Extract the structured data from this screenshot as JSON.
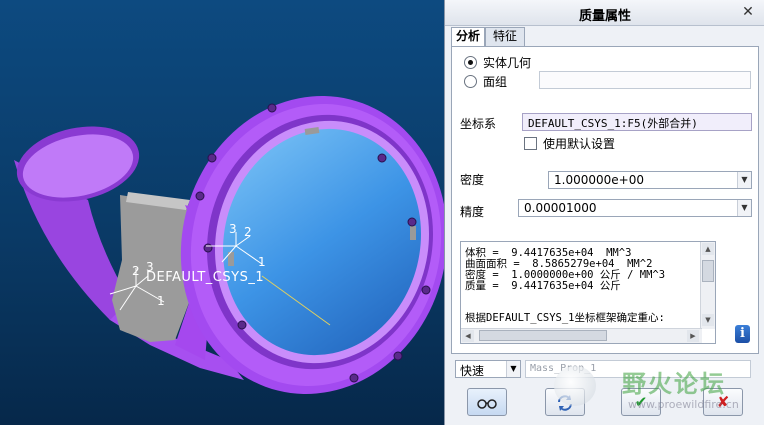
{
  "viewport": {
    "csys_label": "DEFAULT_CSYS_1",
    "axis_labels": [
      "3",
      "2",
      "1",
      "2",
      "3",
      "1"
    ],
    "colors": {
      "part": "#b04ef0",
      "inner": "#3d94e6",
      "web": "#9a9a9a",
      "background": "#0d4a80"
    }
  },
  "dialog": {
    "title": "质量属性",
    "close_icon": "close-icon",
    "tabs": [
      {
        "label": "分析",
        "active": true
      },
      {
        "label": "特征",
        "active": false
      }
    ],
    "solid_geometry_label": "实体几何",
    "surface_label": "面组",
    "coordinate_system_label": "坐标系",
    "coordinate_system_value": "DEFAULT_CSYS_1:F5(外部合并)",
    "use_default_label": "使用默认设置",
    "density_label": "密度",
    "density_value": "1.000000e+00",
    "precision_label": "精度",
    "precision_value": "0.00001000",
    "results_lines": [
      "体积 =  9.4417635e+04  MM^3",
      "曲面面积 =  8.5865279e+04  MM^2",
      "密度 =  1.0000000e+00 公斤 / MM^3",
      "质量 =  9.4417635e+04 公斤"
    ],
    "results_note": "根据DEFAULT_CSYS_1坐标框架确定重心:",
    "mode_value": "快速",
    "name_value": "Mass_Prop_1",
    "buttons": {
      "preview_icon": "glasses-icon",
      "recalculate_icon": "refresh-icon",
      "ok_icon": "check-icon",
      "cancel_icon": "cancel-icon"
    }
  },
  "watermark": {
    "text": "野火论坛",
    "url": "www.proewildfire.cn"
  }
}
